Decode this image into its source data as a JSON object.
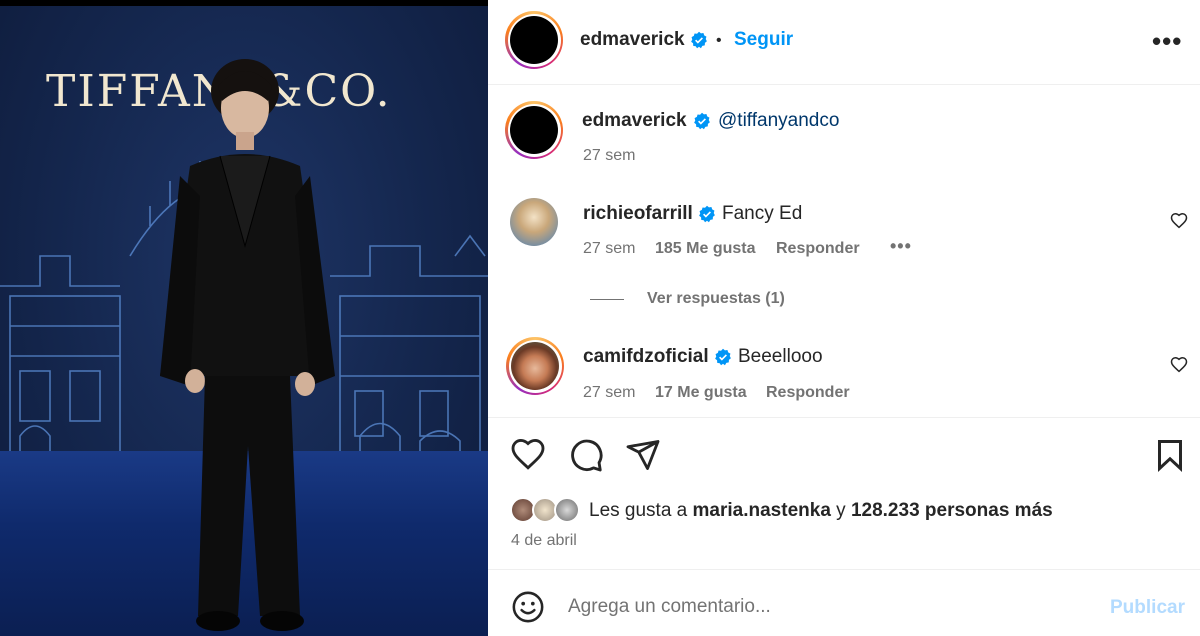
{
  "photo": {
    "logo_text": "TIFFANY&CO."
  },
  "header": {
    "username": "edmaverick",
    "bullet": "•",
    "follow_label": "Seguir",
    "more_label": "•••"
  },
  "caption": {
    "username": "edmaverick",
    "mention": "@tiffanyandco",
    "time": "27 sem"
  },
  "comments": [
    {
      "username": "richieofarrill",
      "text": "Fancy Ed",
      "time": "27 sem",
      "likes": "185 Me gusta",
      "reply_label": "Responder",
      "more_label": "•••",
      "view_replies": "Ver respuestas (1)"
    },
    {
      "username": "camifdzoficial",
      "text": "Beeellooo",
      "time": "27 sem",
      "likes": "17 Me gusta",
      "reply_label": "Responder"
    }
  ],
  "likes": {
    "prefix": "Les gusta a ",
    "user": "maria.nastenka",
    "middle": " y ",
    "count": "128.233 personas más"
  },
  "post_date": "4 de abril",
  "comment_box": {
    "placeholder": "Agrega un comentario...",
    "publish_label": "Publicar"
  },
  "colors": {
    "accent": "#0095f6",
    "verified": "#0095f6",
    "publish_disabled": "#b3dbff",
    "muted_text": "#737373"
  },
  "icons": [
    "verified-badge-icon",
    "more-icon",
    "heart-icon",
    "comment-icon",
    "share-icon",
    "bookmark-icon",
    "emoji-icon"
  ]
}
